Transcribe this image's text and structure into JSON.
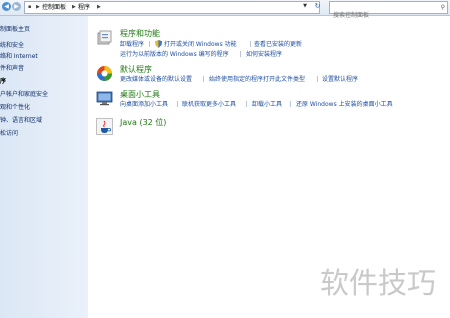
{
  "address": {
    "crumbs": [
      "控制面板",
      "程序"
    ],
    "search_placeholder": "搜索控制面板"
  },
  "sidebar": {
    "items": [
      "制面板主页",
      "统和安全",
      "络和 Internet",
      "件和声音",
      "序",
      "户帐户和家庭安全",
      "观和个性化",
      "钟、语言和区域",
      "松访问"
    ]
  },
  "categories": [
    {
      "title": "程序和功能",
      "links": [
        "卸载程序",
        "打开或关闭 Windows 功能",
        "查看已安装的更新",
        "运行为以前版本的 Windows 编写的程序",
        "如何安装程序"
      ]
    },
    {
      "title": "默认程序",
      "links": [
        "更改媒体或设备的默认设置",
        "始终使用指定的程序打开此文件类型",
        "设置默认程序"
      ]
    },
    {
      "title": "桌面小工具",
      "links": [
        "向桌面添加小工具",
        "联机获取更多小工具",
        "卸载小工具",
        "还原 Windows 上安装的桌面小工具"
      ]
    },
    {
      "title": "Java (32 位)"
    }
  ],
  "watermark": "软件技巧"
}
